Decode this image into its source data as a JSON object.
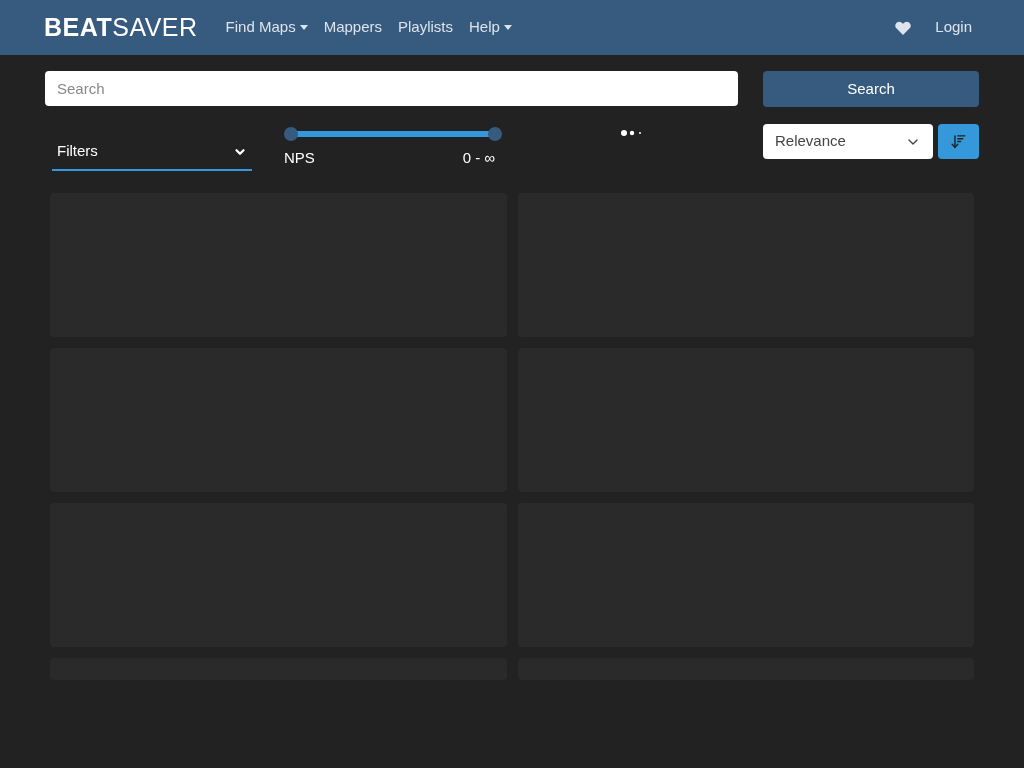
{
  "navbar": {
    "logo_bold": "BEAT",
    "logo_light": "SAVER",
    "links": [
      {
        "label": "Find Maps",
        "dropdown": true
      },
      {
        "label": "Mappers",
        "dropdown": false
      },
      {
        "label": "Playlists",
        "dropdown": false
      },
      {
        "label": "Help",
        "dropdown": true
      }
    ],
    "login": "Login"
  },
  "search": {
    "placeholder": "Search",
    "button": "Search"
  },
  "filters": {
    "label": "Filters"
  },
  "nps": {
    "label": "NPS",
    "reading": "0 - ∞",
    "level": 1
  },
  "sort": {
    "value": "Relevance"
  },
  "cards": [
    {
      "kind": "loading"
    },
    {
      "kind": "loading"
    },
    {
      "kind": "loading"
    },
    {
      "kind": "loading"
    },
    {
      "kind": "loading"
    },
    {
      "kind": "loading"
    },
    {
      "kind": "loading-short"
    },
    {
      "kind": "loading-short"
    }
  ]
}
